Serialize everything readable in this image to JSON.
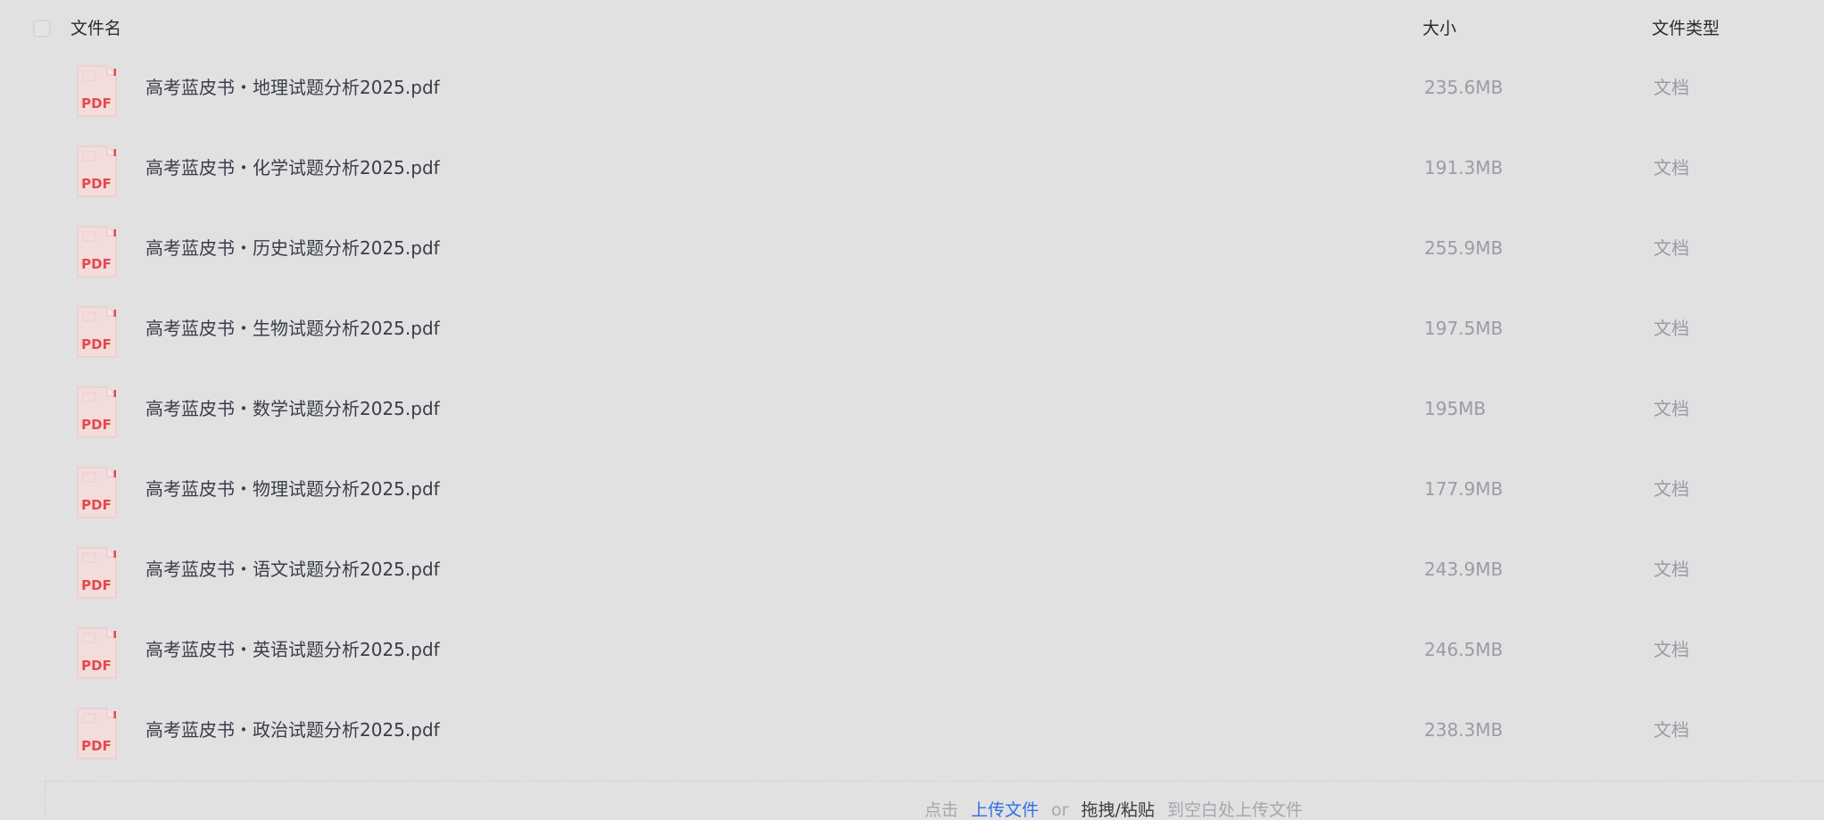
{
  "table": {
    "header": {
      "name": "文件名",
      "size": "大小",
      "type": "文件类型"
    },
    "files": [
      {
        "name": "高考蓝皮书・地理试题分析2025.pdf",
        "size": "235.6MB",
        "type": "文档",
        "icon": "pdf-file-icon",
        "icon_label": "PDF"
      },
      {
        "name": "高考蓝皮书・化学试题分析2025.pdf",
        "size": "191.3MB",
        "type": "文档",
        "icon": "pdf-file-icon",
        "icon_label": "PDF"
      },
      {
        "name": "高考蓝皮书・历史试题分析2025.pdf",
        "size": "255.9MB",
        "type": "文档",
        "icon": "pdf-file-icon",
        "icon_label": "PDF"
      },
      {
        "name": "高考蓝皮书・生物试题分析2025.pdf",
        "size": "197.5MB",
        "type": "文档",
        "icon": "pdf-file-icon",
        "icon_label": "PDF"
      },
      {
        "name": "高考蓝皮书・数学试题分析2025.pdf",
        "size": "195MB",
        "type": "文档",
        "icon": "pdf-file-icon",
        "icon_label": "PDF"
      },
      {
        "name": "高考蓝皮书・物理试题分析2025.pdf",
        "size": "177.9MB",
        "type": "文档",
        "icon": "pdf-file-icon",
        "icon_label": "PDF"
      },
      {
        "name": "高考蓝皮书・语文试题分析2025.pdf",
        "size": "243.9MB",
        "type": "文档",
        "icon": "pdf-file-icon",
        "icon_label": "PDF"
      },
      {
        "name": "高考蓝皮书・英语试题分析2025.pdf",
        "size": "246.5MB",
        "type": "文档",
        "icon": "pdf-file-icon",
        "icon_label": "PDF"
      },
      {
        "name": "高考蓝皮书・政治试题分析2025.pdf",
        "size": "238.3MB",
        "type": "文档",
        "icon": "pdf-file-icon",
        "icon_label": "PDF"
      }
    ]
  },
  "upload": {
    "prefix": "点击",
    "upload_link": "上传文件",
    "or": "or",
    "drag_paste": "拖拽/粘贴",
    "suffix": "到空白处上传文件"
  },
  "colors": {
    "background": "#e1e1e1",
    "pdf_red": "#e8474c",
    "link_blue": "#2f6fe6",
    "text_primary": "#3a3d4a",
    "text_muted": "#9a9ca6"
  }
}
